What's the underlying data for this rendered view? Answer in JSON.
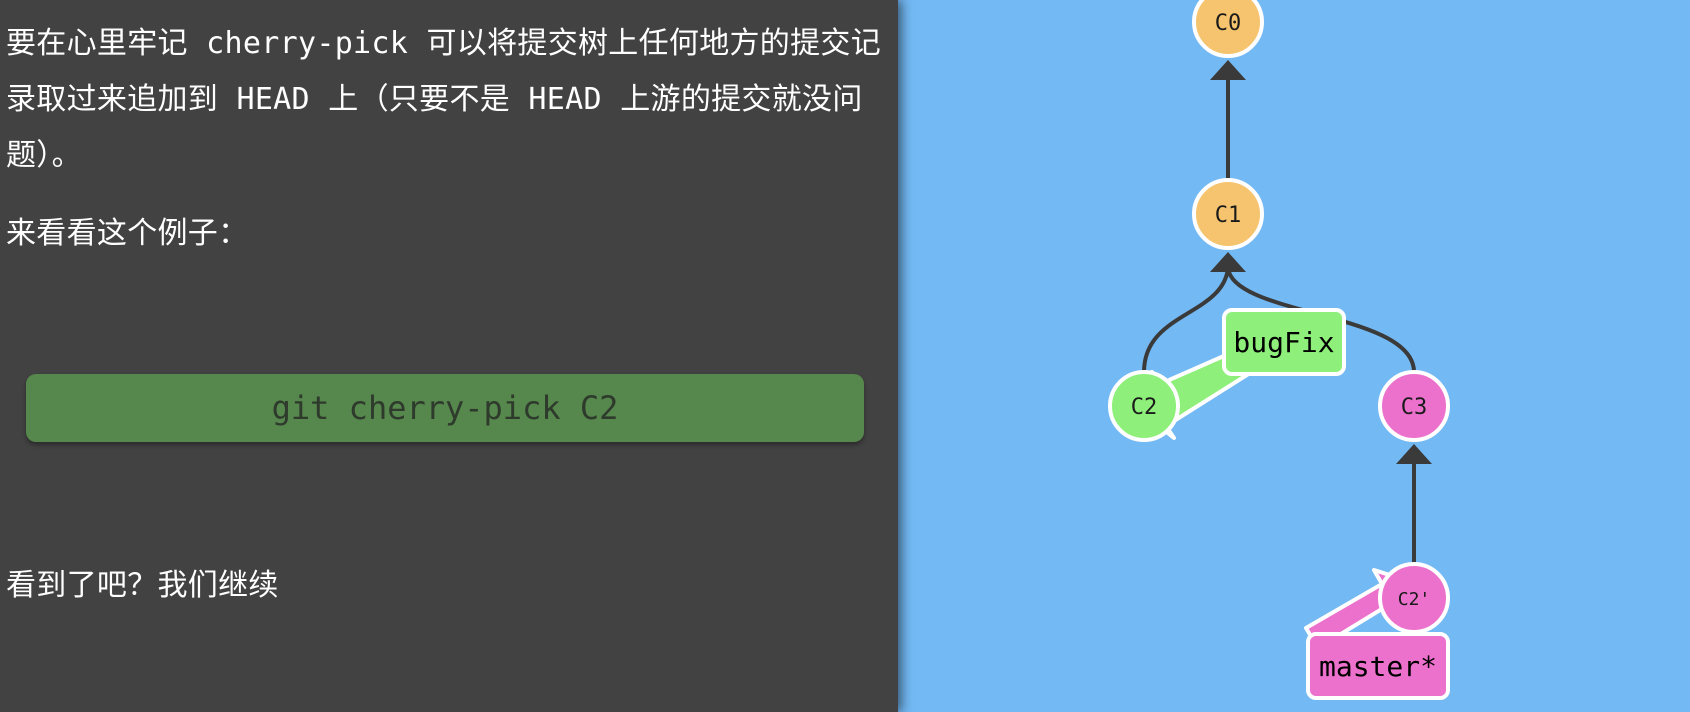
{
  "instructions": {
    "paragraph_1": "要在心里牢记 cherry-pick 可以将提交树上任何地方的提交记录取过来追加到 HEAD 上（只要不是 HEAD 上游的提交就没问题）。",
    "paragraph_2": "来看看这个例子：",
    "command": "git cherry-pick C2",
    "paragraph_3": "看到了吧？我们继续"
  },
  "commit_graph": {
    "commits": [
      {
        "id": "C0",
        "color": "#f6c46e"
      },
      {
        "id": "C1",
        "color": "#f6c46e"
      },
      {
        "id": "C2",
        "color": "#8ef07a"
      },
      {
        "id": "C3",
        "color": "#ec71cc"
      },
      {
        "id": "C2'",
        "color": "#ec71cc"
      }
    ],
    "branches": [
      {
        "name": "bugFix",
        "target": "C2",
        "color": "#8ef07a"
      },
      {
        "name": "master*",
        "target": "C2'",
        "color": "#ec71cc"
      }
    ],
    "colors": {
      "background": "#73b9f4",
      "edge": "#3a3a3a",
      "node_border": "#ffffff"
    }
  }
}
